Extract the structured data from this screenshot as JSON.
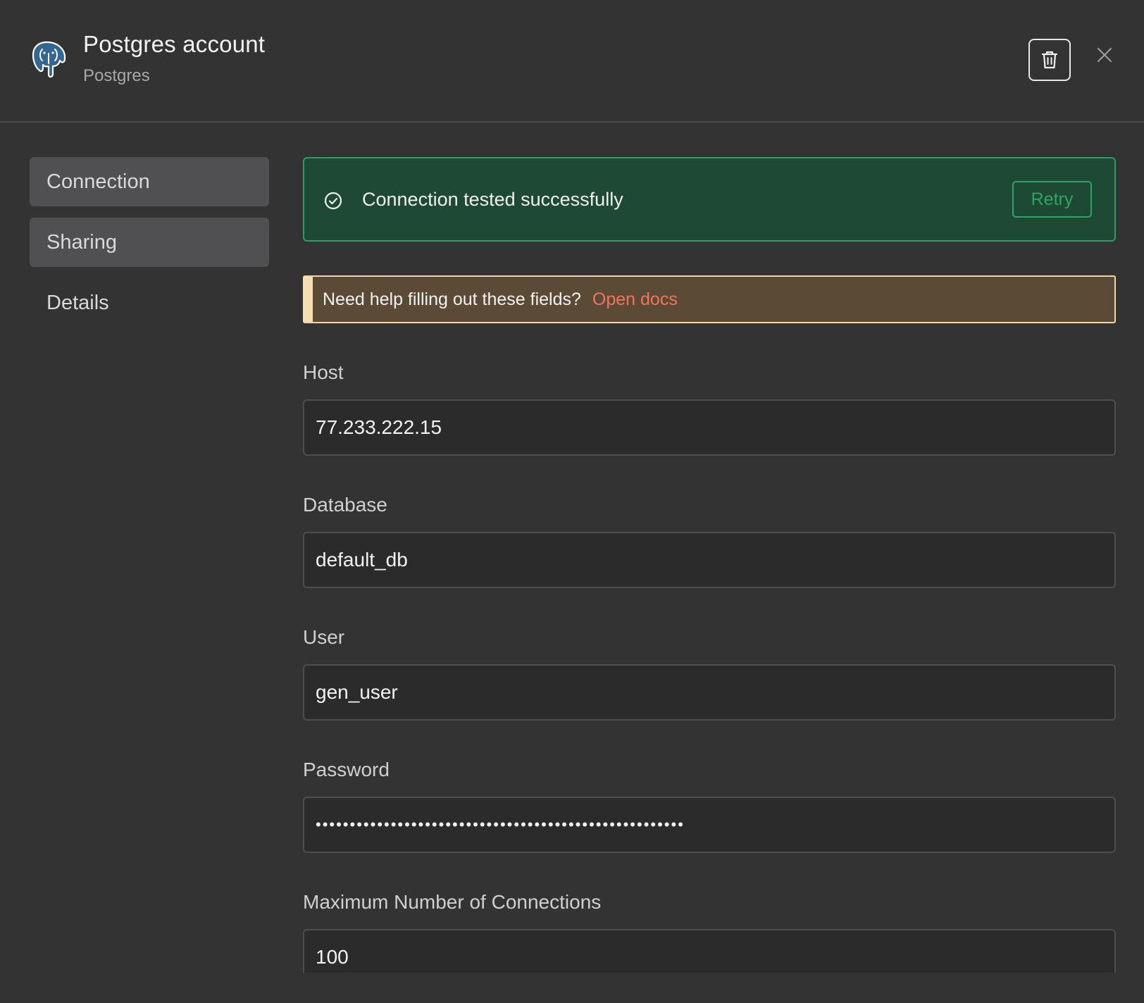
{
  "header": {
    "title": "Postgres account",
    "subtitle": "Postgres",
    "logo_icon": "postgres-elephant-icon",
    "delete_icon": "trash-icon",
    "close_icon": "close-icon"
  },
  "sidebar": {
    "items": [
      {
        "label": "Connection"
      },
      {
        "label": "Sharing"
      },
      {
        "label": "Details"
      }
    ]
  },
  "status": {
    "message": "Connection tested successfully",
    "retry_label": "Retry",
    "icon": "check-circle-icon",
    "color": "#2ea465"
  },
  "help": {
    "text": "Need help filling out these fields?",
    "link": "Open docs"
  },
  "fields": [
    {
      "label": "Host",
      "value": "77.233.222.15"
    },
    {
      "label": "Database",
      "value": "default_db"
    },
    {
      "label": "User",
      "value": "gen_user"
    },
    {
      "label": "Password",
      "value": "••••••••••••••••••••••••••••••••••••••••••••••••••••••"
    },
    {
      "label": "Maximum Number of Connections",
      "value": "100"
    }
  ]
}
